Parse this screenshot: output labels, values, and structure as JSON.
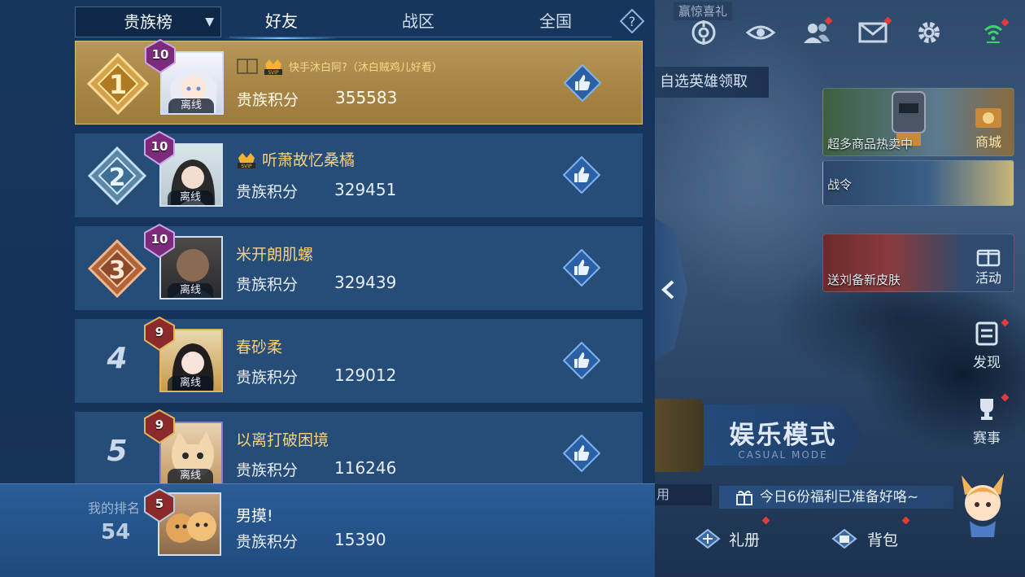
{
  "leaderboard": {
    "dropdown_label": "贵族榜",
    "tabs": [
      {
        "label": "好友",
        "active": true
      },
      {
        "label": "战区",
        "active": false
      },
      {
        "label": "全国",
        "active": false
      }
    ],
    "rows": [
      {
        "rank": "1",
        "level": "10",
        "name": "快手沐白阿?（沐白贼鸡儿好看）",
        "vip": "SVIP",
        "score_label": "贵族积分",
        "score": "355583",
        "offline": "离线"
      },
      {
        "rank": "2",
        "level": "10",
        "name": "听萧故忆桑橘",
        "vip": "SVIP",
        "score_label": "贵族积分",
        "score": "329451",
        "offline": "离线"
      },
      {
        "rank": "3",
        "level": "10",
        "name": "米开朗肌螺",
        "score_label": "贵族积分",
        "score": "329439",
        "offline": "离线"
      },
      {
        "rank": "4",
        "level": "9",
        "name": "春砂柔",
        "score_label": "贵族积分",
        "score": "129012",
        "offline": "离线"
      },
      {
        "rank": "5",
        "level": "9",
        "name": "以离打破困境",
        "score_label": "贵族积分",
        "score": "116246",
        "offline": "离线"
      }
    ],
    "my_rank": {
      "label": "我的排名",
      "rank": "54",
      "level": "5",
      "name": "男摸!",
      "score_label": "贵族积分",
      "score": "15390"
    }
  },
  "lobby": {
    "gift_tag": "赢惊喜礼",
    "pick_hero": "自选英雄领取",
    "cards": [
      {
        "caption": "超多商品热卖中",
        "side_label": "商城"
      },
      {
        "caption": "战令"
      },
      {
        "caption": "送刘备新皮肤",
        "side_label": "活动"
      }
    ],
    "side_buttons": [
      "发现",
      "赛事"
    ],
    "mode": {
      "title": "娱乐模式",
      "subtitle": "CASUAL MODE"
    },
    "welfare_banner": "今日6份福利已准备好咯~",
    "use_tag": "用",
    "bottom": {
      "gift_pack": "礼册",
      "bag": "背包"
    }
  },
  "colors": {
    "gold_row": "#a88545",
    "row": "#264c78",
    "panel": "#15325a",
    "name": "#f7d27a",
    "alert": "#e23b3b"
  }
}
